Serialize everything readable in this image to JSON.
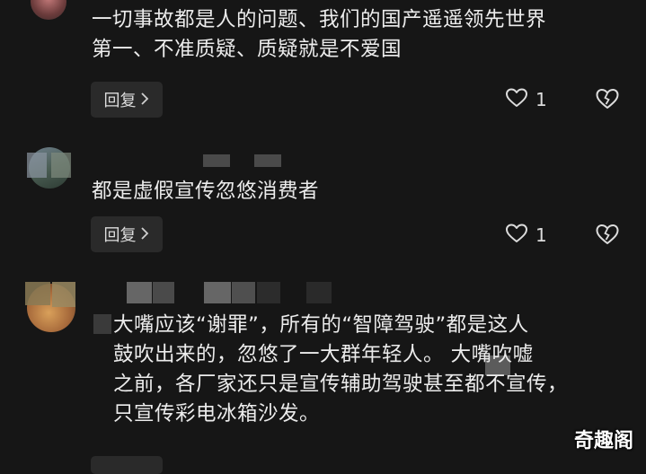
{
  "comments": [
    {
      "text": "一切事故都是人的问题、我们的国产遥遥领先世界\n第一、不准质疑、质疑就是不爱国",
      "reply_label": "回复",
      "likes": "1"
    },
    {
      "text": "都是虚假宣传忽悠消费者",
      "reply_label": "回复",
      "likes": "1"
    },
    {
      "text": "大嘴应该“谢罪”，所有的“智障驾驶”都是这人\n鼓吹出来的，忽悠了一大群年轻人。 大嘴吹嘘\n之前，各厂家还只是宣传辅助驾驶甚至都不宣传，\n只宣传彩电冰箱沙发。"
    }
  ],
  "watermark": "奇趣阁",
  "icons": {
    "reply_chevron": "chevron-right-icon",
    "like": "heart-outline-icon",
    "dislike": "broken-heart-icon"
  },
  "colors": {
    "background": "#161616",
    "text": "#ececec",
    "button_bg": "#2a2a2a"
  }
}
